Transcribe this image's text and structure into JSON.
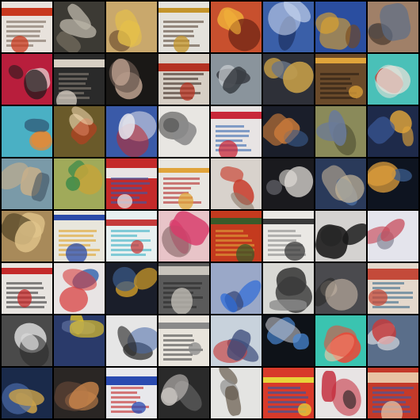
{
  "grid": {
    "rows": 8,
    "cols": 8,
    "tiles": [
      {
        "bg": "#e8e2dc",
        "accent": "#c8381e",
        "ink": "#7a6a5e",
        "kind": "text"
      },
      {
        "bg": "#3c3a34",
        "accent": "#b8b2a6",
        "ink": "#6b6458",
        "kind": "photo"
      },
      {
        "bg": "#c9a86c",
        "accent": "#e6c04a",
        "ink": "#6a4a2c",
        "kind": "photo"
      },
      {
        "bg": "#e4e2dc",
        "accent": "#c4942a",
        "ink": "#5c4a3a",
        "kind": "text"
      },
      {
        "bg": "#c8502e",
        "accent": "#f0b23a",
        "ink": "#7a2a18",
        "kind": "photo"
      },
      {
        "bg": "#3a5fa8",
        "accent": "#c6d4ec",
        "ink": "#1e3466",
        "kind": "photo"
      },
      {
        "bg": "#2a4ea0",
        "accent": "#e0a42c",
        "ink": "#7a4818",
        "kind": "photo"
      },
      {
        "bg": "#a08068",
        "accent": "#5a6e8a",
        "ink": "#4a3a2e",
        "kind": "photo"
      },
      {
        "bg": "#b81e3c",
        "accent": "#1a1a1a",
        "ink": "#e8e0dc",
        "kind": "photo"
      },
      {
        "bg": "#2a2a2a",
        "accent": "#d8d0c4",
        "ink": "#8a8278",
        "kind": "text"
      },
      {
        "bg": "#1a1816",
        "accent": "#c4a694",
        "ink": "#6a5a50",
        "kind": "photo"
      },
      {
        "bg": "#d6cec4",
        "accent": "#b43222",
        "ink": "#3a2a22",
        "kind": "text"
      },
      {
        "bg": "#8a949c",
        "accent": "#3a3e44",
        "ink": "#c8ccd0",
        "kind": "photo"
      },
      {
        "bg": "#2e3038",
        "accent": "#c8a048",
        "ink": "#6a7688",
        "kind": "photo"
      },
      {
        "bg": "#6a4a2a",
        "accent": "#e0a43a",
        "ink": "#2a1e14",
        "kind": "text"
      },
      {
        "bg": "#4ac0b8",
        "accent": "#e4e0d8",
        "ink": "#c0322a",
        "kind": "photo"
      },
      {
        "bg": "#4ab0c4",
        "accent": "#e08a3a",
        "ink": "#2a4a6a",
        "kind": "photo"
      },
      {
        "bg": "#6a5a2a",
        "accent": "#f0d8b0",
        "ink": "#c43a1e",
        "kind": "photo"
      },
      {
        "bg": "#3a5aa8",
        "accent": "#e4e4ec",
        "ink": "#c42a2a",
        "kind": "photo"
      },
      {
        "bg": "#e8e6e2",
        "accent": "#4a4a4a",
        "ink": "#8a8a8a",
        "kind": "photo"
      },
      {
        "bg": "#e8e4e4",
        "accent": "#c8283a",
        "ink": "#3a6ab0",
        "kind": "text"
      },
      {
        "bg": "#1a1e2a",
        "accent": "#c87a3a",
        "ink": "#3a5a8a",
        "kind": "photo"
      },
      {
        "bg": "#8a8a5a",
        "accent": "#6a7a9a",
        "ink": "#4a4a30",
        "kind": "photo"
      },
      {
        "bg": "#1e2a4a",
        "accent": "#e0a43a",
        "ink": "#3a5a9a",
        "kind": "photo"
      },
      {
        "bg": "#7a9aa8",
        "accent": "#c8b08a",
        "ink": "#3a4a5a",
        "kind": "photo"
      },
      {
        "bg": "#a0aa5a",
        "accent": "#3a8a4a",
        "ink": "#c4a43a",
        "kind": "photo"
      },
      {
        "bg": "#c42a2a",
        "accent": "#e8e4e4",
        "ink": "#3a5aa8",
        "kind": "text"
      },
      {
        "bg": "#e8e6e0",
        "accent": "#e0a43a",
        "ink": "#b42a2a",
        "kind": "text"
      },
      {
        "bg": "#d8d2cc",
        "accent": "#c83a2a",
        "ink": "#8a7a6a",
        "kind": "photo"
      },
      {
        "bg": "#1a1a1e",
        "accent": "#e6e2dc",
        "ink": "#6a6a70",
        "kind": "photo"
      },
      {
        "bg": "#2a3a5a",
        "accent": "#c8b89a",
        "ink": "#4a6a9a",
        "kind": "photo"
      },
      {
        "bg": "#0e1420",
        "accent": "#d89a3a",
        "ink": "#3a5a8a",
        "kind": "photo"
      },
      {
        "bg": "#a88a5a",
        "accent": "#e0c48a",
        "ink": "#5a4a2a",
        "kind": "photo"
      },
      {
        "bg": "#e8e6dc",
        "accent": "#2a4aa8",
        "ink": "#e0a42a",
        "kind": "text"
      },
      {
        "bg": "#e8f0f0",
        "accent": "#c43a3a",
        "ink": "#3ab0c4",
        "kind": "text"
      },
      {
        "bg": "#e8c4c8",
        "accent": "#d83a6a",
        "ink": "#8a6a6a",
        "kind": "photo"
      },
      {
        "bg": "#c43a1e",
        "accent": "#3a5a2a",
        "ink": "#e0a43a",
        "kind": "text"
      },
      {
        "bg": "#eae8e4",
        "accent": "#3a3a3a",
        "ink": "#8a8a8a",
        "kind": "text"
      },
      {
        "bg": "#d4d2d0",
        "accent": "#1a1a1a",
        "ink": "#7a7a7a",
        "kind": "photo"
      },
      {
        "bg": "#e4e4ec",
        "accent": "#c84a5a",
        "ink": "#8a8a9a",
        "kind": "photo"
      },
      {
        "bg": "#e8e4e0",
        "accent": "#c42a2a",
        "ink": "#3a3a3a",
        "kind": "text"
      },
      {
        "bg": "#e8e4e4",
        "accent": "#d83a3a",
        "ink": "#3a6ab0",
        "kind": "photo"
      },
      {
        "bg": "#1a1e2a",
        "accent": "#c4942a",
        "ink": "#3a5a8a",
        "kind": "photo"
      },
      {
        "bg": "#5a5a5a",
        "accent": "#c8c4bc",
        "ink": "#2a2a2a",
        "kind": "text"
      },
      {
        "bg": "#9aa8c8",
        "accent": "#2a6ad8",
        "ink": "#3a4a7a",
        "kind": "photo"
      },
      {
        "bg": "#d8d8d4",
        "accent": "#3a3a3a",
        "ink": "#8a8a8a",
        "kind": "photo"
      },
      {
        "bg": "#4a4a4e",
        "accent": "#c4b4a4",
        "ink": "#2a2a2a",
        "kind": "photo"
      },
      {
        "bg": "#e4d8cc",
        "accent": "#c44a3a",
        "ink": "#3a6a8a",
        "kind": "text"
      },
      {
        "bg": "#4a4a4a",
        "accent": "#d8d8d8",
        "ink": "#2a2a2a",
        "kind": "photo"
      },
      {
        "bg": "#2a3a6a",
        "accent": "#e8c82a",
        "ink": "#5a6a9a",
        "kind": "photo"
      },
      {
        "bg": "#e6e6e6",
        "accent": "#2a2a2a",
        "ink": "#4a6aa8",
        "kind": "photo"
      },
      {
        "bg": "#e8e4dc",
        "accent": "#8a8a8a",
        "ink": "#4a4a4a",
        "kind": "text"
      },
      {
        "bg": "#c8d2dc",
        "accent": "#3a4a7a",
        "ink": "#c83a3a",
        "kind": "photo"
      },
      {
        "bg": "#0e1218",
        "accent": "#4a8ad8",
        "ink": "#c8c8d0",
        "kind": "photo"
      },
      {
        "bg": "#3ac4b0",
        "accent": "#e84a3a",
        "ink": "#e8c8a8",
        "kind": "photo"
      },
      {
        "bg": "#5a6e8a",
        "accent": "#e8e8ea",
        "ink": "#c83a3a",
        "kind": "photo"
      },
      {
        "bg": "#1a2a4a",
        "accent": "#c8a04a",
        "ink": "#4a6aa8",
        "kind": "photo"
      },
      {
        "bg": "#2a2624",
        "accent": "#c8844a",
        "ink": "#6a4a3a",
        "kind": "photo"
      },
      {
        "bg": "#e8e8ec",
        "accent": "#2a4ab0",
        "ink": "#c42a2a",
        "kind": "text"
      },
      {
        "bg": "#2a2a2a",
        "accent": "#c8c4c0",
        "ink": "#6a6a6a",
        "kind": "photo"
      },
      {
        "bg": "#e4e4e2",
        "accent": "#4a3a2a",
        "ink": "#8a8a8a",
        "kind": "photo"
      },
      {
        "bg": "#d83a2a",
        "accent": "#e8d43a",
        "ink": "#2a5aa8",
        "kind": "text"
      },
      {
        "bg": "#e8e4e4",
        "accent": "#c42a3a",
        "ink": "#1a1a1a",
        "kind": "photo"
      },
      {
        "bg": "#c43a2a",
        "accent": "#e8c4a4",
        "ink": "#3a5aa8",
        "kind": "text"
      }
    ]
  }
}
